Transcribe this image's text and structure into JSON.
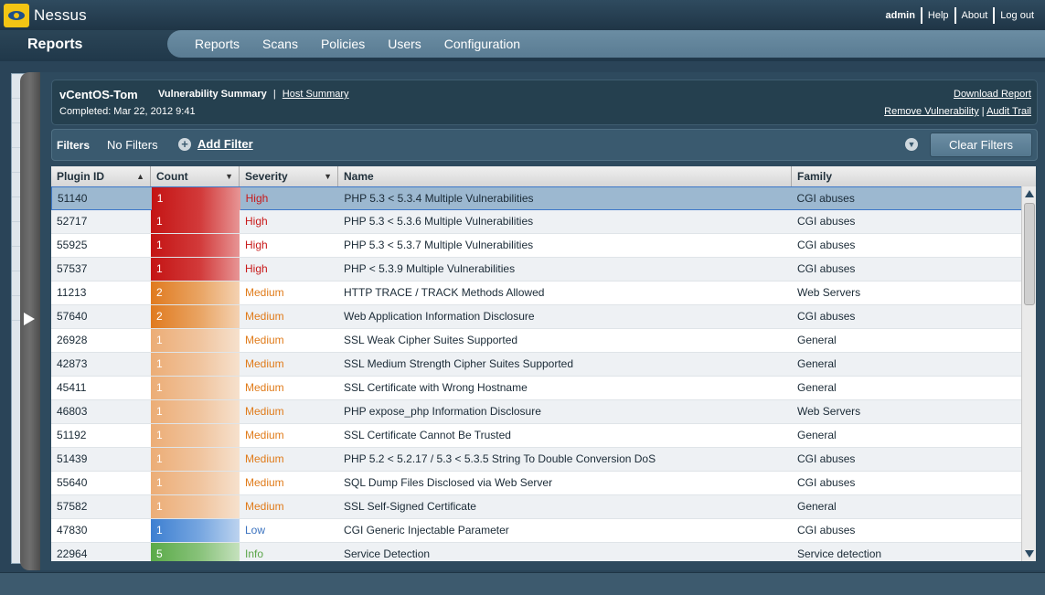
{
  "app": {
    "logo_text": "Nessus"
  },
  "top_links": {
    "user": "admin",
    "help": "Help",
    "about": "About",
    "logout": "Log out"
  },
  "nav": {
    "section_title": "Reports",
    "tabs": [
      "Reports",
      "Scans",
      "Policies",
      "Users",
      "Configuration"
    ]
  },
  "report": {
    "host": "vCentOS-Tom",
    "vuln_summary": "Vulnerability Summary",
    "separator": "|",
    "host_summary": "Host Summary",
    "completed": "Completed: Mar 22, 2012 9:41",
    "download_report": "Download Report",
    "remove_vulnerability": "Remove Vulnerability",
    "audit_trail": "Audit Trail"
  },
  "filters": {
    "label": "Filters",
    "status": "No Filters",
    "add_filter": "Add Filter",
    "clear_filters": "Clear Filters"
  },
  "table": {
    "columns": [
      "Plugin ID",
      "Count",
      "Severity",
      "Name",
      "Family"
    ],
    "rows": [
      {
        "id": "51140",
        "count": "1",
        "severity": "High",
        "name": "PHP 5.3 < 5.3.4 Multiple Vulnerabilities",
        "family": "CGI abuses"
      },
      {
        "id": "52717",
        "count": "1",
        "severity": "High",
        "name": "PHP 5.3 < 5.3.6 Multiple Vulnerabilities",
        "family": "CGI abuses"
      },
      {
        "id": "55925",
        "count": "1",
        "severity": "High",
        "name": "PHP 5.3 < 5.3.7 Multiple Vulnerabilities",
        "family": "CGI abuses"
      },
      {
        "id": "57537",
        "count": "1",
        "severity": "High",
        "name": "PHP < 5.3.9 Multiple Vulnerabilities",
        "family": "CGI abuses"
      },
      {
        "id": "11213",
        "count": "2",
        "severity": "Medium",
        "name": "HTTP TRACE / TRACK Methods Allowed",
        "family": "Web Servers"
      },
      {
        "id": "57640",
        "count": "2",
        "severity": "Medium",
        "name": "Web Application Information Disclosure",
        "family": "CGI abuses"
      },
      {
        "id": "26928",
        "count": "1",
        "severity": "Medium",
        "name": "SSL Weak Cipher Suites Supported",
        "family": "General"
      },
      {
        "id": "42873",
        "count": "1",
        "severity": "Medium",
        "name": "SSL Medium Strength Cipher Suites Supported",
        "family": "General"
      },
      {
        "id": "45411",
        "count": "1",
        "severity": "Medium",
        "name": "SSL Certificate with Wrong Hostname",
        "family": "General"
      },
      {
        "id": "46803",
        "count": "1",
        "severity": "Medium",
        "name": "PHP expose_php Information Disclosure",
        "family": "Web Servers"
      },
      {
        "id": "51192",
        "count": "1",
        "severity": "Medium",
        "name": "SSL Certificate Cannot Be Trusted",
        "family": "General"
      },
      {
        "id": "51439",
        "count": "1",
        "severity": "Medium",
        "name": "PHP 5.2 < 5.2.17 / 5.3 < 5.3.5 String To Double Conversion DoS",
        "family": "CGI abuses"
      },
      {
        "id": "55640",
        "count": "1",
        "severity": "Medium",
        "name": "SQL Dump Files Disclosed via Web Server",
        "family": "CGI abuses"
      },
      {
        "id": "57582",
        "count": "1",
        "severity": "Medium",
        "name": "SSL Self-Signed Certificate",
        "family": "General"
      },
      {
        "id": "47830",
        "count": "1",
        "severity": "Low",
        "name": "CGI Generic Injectable Parameter",
        "family": "CGI abuses"
      },
      {
        "id": "22964",
        "count": "5",
        "severity": "Info",
        "name": "Service Detection",
        "family": "Service detection"
      }
    ]
  },
  "colors": {
    "high": "#c81a1a",
    "medium": "#e07b1a",
    "low": "#3a72bf",
    "info": "#5aa548",
    "selected_row": "#9cb8d0"
  }
}
